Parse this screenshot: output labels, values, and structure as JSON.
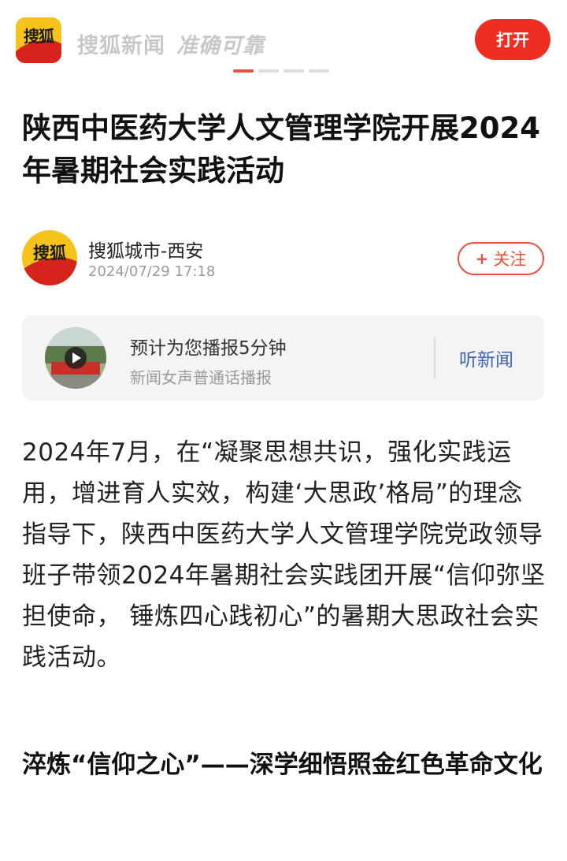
{
  "header": {
    "logo_text": "搜狐",
    "brand": "搜狐新闻",
    "slogan": "准确可靠",
    "open_button": "打开",
    "carousel_pages": 4,
    "carousel_active": 1
  },
  "article": {
    "title": "陕西中医药大学人文管理学院开展2024年暑期社会实践活动",
    "author": {
      "avatar_text": "搜狐",
      "name": "搜狐城市-西安",
      "time": "2024/07/29 17:18",
      "follow_label": "关注",
      "follow_icon": "+"
    },
    "audio": {
      "title": "预计为您播报5分钟",
      "subtitle": "新闻女声普通话播报",
      "listen_label": "听新闻"
    },
    "paragraph": "2024年7月，在“凝聚思想共识，强化实践运用，增进育人实效，构建‘大思政’格局”的理念指导下，陕西中医药大学人文管理学院党政领导班子带领2024年暑期社会实践团开展“信仰弥坚担使命， 锤炼四心践初心”的暑期大思政社会实践活动。",
    "subheading": "淬炼“信仰之心”——深学细悟照金红色革命文化"
  },
  "colors": {
    "accent": "#ee2e22",
    "link_blue": "#3a63b8",
    "logo_yellow": "#f6c21c",
    "logo_red": "#d6241c"
  }
}
